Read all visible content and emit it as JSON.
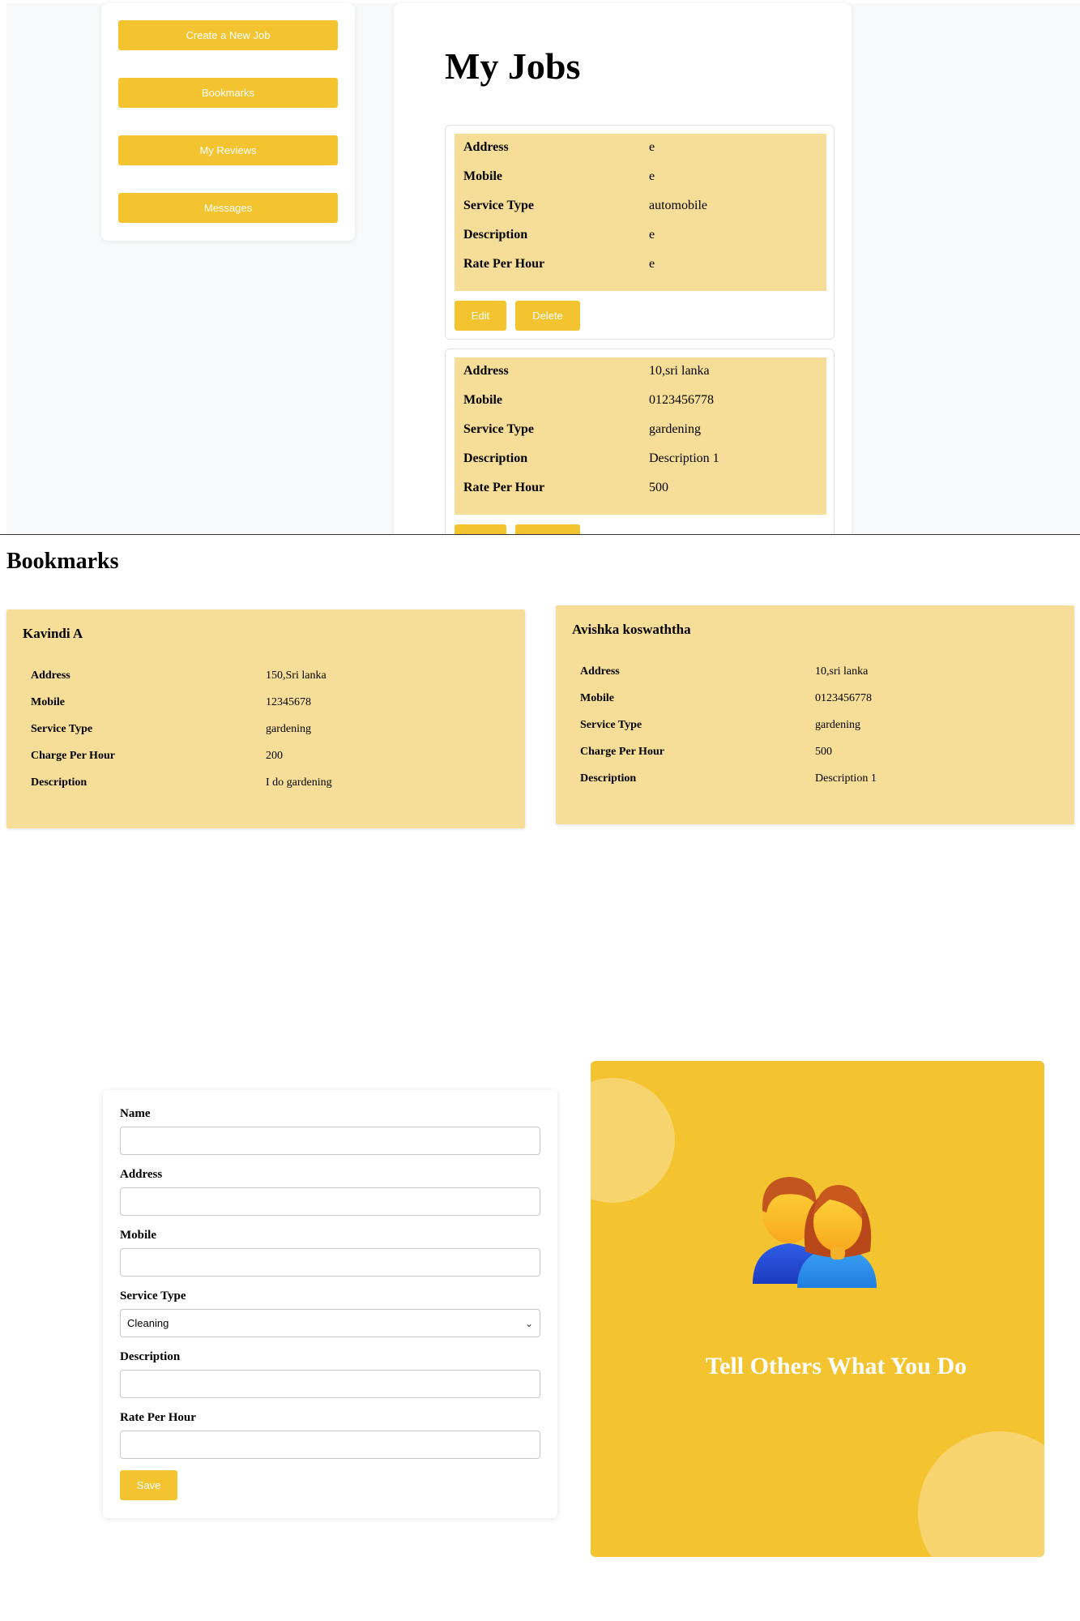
{
  "sidebar": {
    "buttons": [
      "Create a New Job",
      "Bookmarks",
      "My Reviews",
      "Messages"
    ]
  },
  "my_jobs": {
    "title": "My Jobs",
    "jobs": [
      {
        "fields": [
          {
            "label": "Address",
            "value": "e"
          },
          {
            "label": "Mobile",
            "value": "e"
          },
          {
            "label": "Service Type",
            "value": "automobile"
          },
          {
            "label": "Description",
            "value": "e"
          },
          {
            "label": "Rate Per Hour",
            "value": "e"
          }
        ],
        "edit_label": "Edit",
        "delete_label": "Delete"
      },
      {
        "fields": [
          {
            "label": "Address",
            "value": "10,sri lanka"
          },
          {
            "label": "Mobile",
            "value": "0123456778"
          },
          {
            "label": "Service Type",
            "value": "gardening"
          },
          {
            "label": "Description",
            "value": "Description 1"
          },
          {
            "label": "Rate Per Hour",
            "value": "500"
          }
        ],
        "edit_label": "",
        "delete_label": ""
      }
    ]
  },
  "bookmarks": {
    "title": "Bookmarks",
    "items": [
      {
        "name": "Kavindi A",
        "fields": [
          {
            "label": "Address",
            "value": "150,Sri lanka"
          },
          {
            "label": "Mobile",
            "value": "12345678"
          },
          {
            "label": "Service Type",
            "value": "gardening"
          },
          {
            "label": "Charge Per Hour",
            "value": "200"
          },
          {
            "label": "Description",
            "value": "I do gardening"
          }
        ]
      },
      {
        "name": "Avishka koswaththa",
        "fields": [
          {
            "label": "Address",
            "value": "10,sri lanka"
          },
          {
            "label": "Mobile",
            "value": "0123456778"
          },
          {
            "label": "Service Type",
            "value": "gardening"
          },
          {
            "label": "Charge Per Hour",
            "value": "500"
          },
          {
            "label": "Description",
            "value": "Description 1"
          }
        ]
      }
    ]
  },
  "form": {
    "name_label": "Name",
    "address_label": "Address",
    "mobile_label": "Mobile",
    "service_type_label": "Service Type",
    "service_type_value": "Cleaning",
    "description_label": "Description",
    "rate_label": "Rate Per Hour",
    "save_label": "Save"
  },
  "promo": {
    "text": "Tell Others What You Do",
    "icon": "people-icon"
  },
  "colors": {
    "accent": "#f4c430",
    "card_bg": "#f7de98",
    "promo_circle": "#f7d46e"
  }
}
